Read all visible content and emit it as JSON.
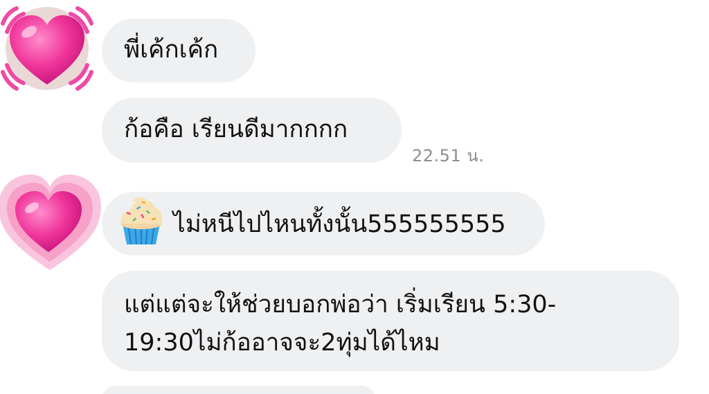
{
  "messages": [
    {
      "text": "พี่เค้กเค้ก"
    },
    {
      "text": "ก้อคือ เรียนดีมากกกก",
      "timestamp": "22.51 น."
    },
    {
      "emoji": "cupcake-icon",
      "text": "ไม่หนีไปไหนทั้งนั้น555555555"
    },
    {
      "line1": "แต่แต่จะให้ช่วยบอกพ่อว่า เริ่มเรียน 5:30-",
      "line2": "19:30ไม่ก้ออาจจะ2ทุ่มได้ไหม"
    }
  ],
  "avatars": [
    {
      "icon": "beating-heart-icon"
    },
    {
      "icon": "growing-heart-icon"
    }
  ],
  "colors": {
    "bubble": "#eff0f2",
    "heart": "#f0359a",
    "heart_glow": "#f7a9cf",
    "timestamp": "#8a8d91"
  }
}
